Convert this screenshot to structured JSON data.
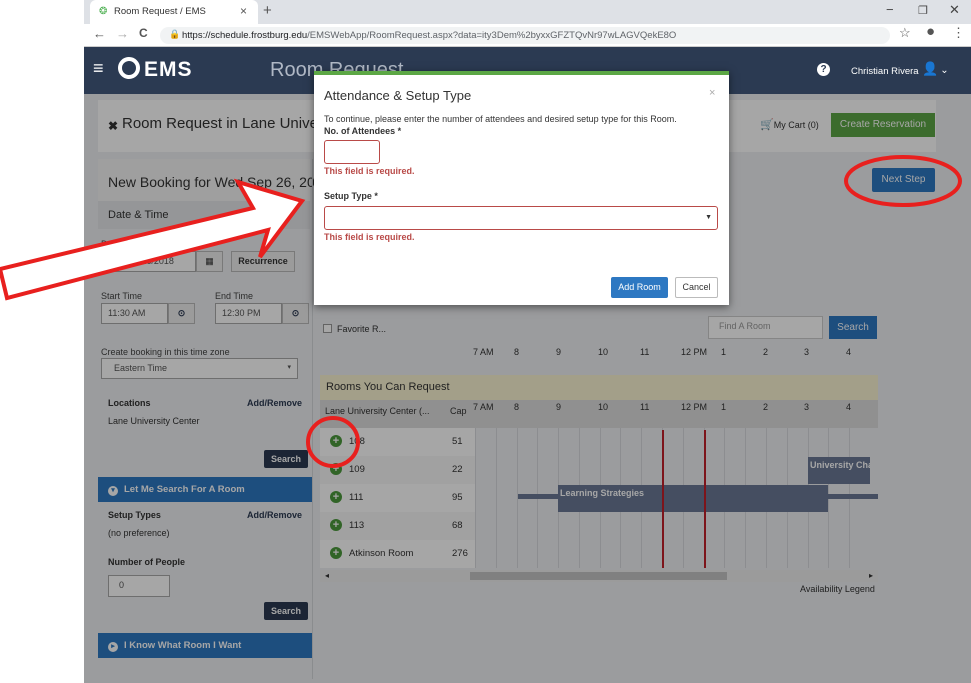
{
  "browser": {
    "tab_title": "Room Request / EMS",
    "tab_close": "×",
    "new_tab": "+",
    "url_host": "https://schedule.frostburg.edu",
    "url_path": "/EMSWebApp/RoomRequest.aspx?data=ity3Dem%2byxxGFZTQvNr97wLAGVQekE8O",
    "minimize": "−",
    "maximize": "❐",
    "close": "✕",
    "back": "←",
    "forward": "→",
    "reload": "C",
    "star": "☆",
    "menu": "⋮",
    "profile": "●"
  },
  "header": {
    "brand": "EMS",
    "page_title": "Room Request",
    "help": "?",
    "user_name": "Christian Rivera",
    "caret": "⌄"
  },
  "request": {
    "title": "Room Request in Lane University Center",
    "cart": "My Cart (0)",
    "create_reservation": "Create Reservation",
    "booking_title": "New Booking for Wed Sep 26, 2018",
    "next_step": "Next Step"
  },
  "sidebar": {
    "date_time_header": "Date & Time",
    "date_label": "Date",
    "date_value": "Wed 09/26/2018",
    "recurrence": "Recurrence",
    "start_time_label": "Start Time",
    "start_time": "11:30 AM",
    "end_time_label": "End Time",
    "end_time": "12:30 PM",
    "timezone_label": "Create booking in this time zone",
    "timezone_value": "Eastern Time",
    "locations_label": "Locations",
    "add_remove": "Add/Remove",
    "location_value": "Lane University Center",
    "search": "Search",
    "let_me_search": "Let Me Search For A Room",
    "setup_types_label": "Setup Types",
    "setup_value": "(no preference)",
    "people_label": "Number of People",
    "people_value": "0",
    "i_know": "I Know What Room I Want"
  },
  "grid": {
    "favorite": "Favorite R...",
    "find_room_placeholder": "Find A Room",
    "search": "Search",
    "hours": [
      "7 AM",
      "8",
      "9",
      "10",
      "11",
      "12 PM",
      "1",
      "2",
      "3",
      "4"
    ],
    "rooms_header": "Rooms You Can Request",
    "building_col": "Lane University Center (...",
    "cap_col": "Cap",
    "rooms": [
      {
        "name": "108",
        "cap": "51"
      },
      {
        "name": "109",
        "cap": "22"
      },
      {
        "name": "111",
        "cap": "95"
      },
      {
        "name": "113",
        "cap": "68"
      },
      {
        "name": "Atkinson Room",
        "cap": "276"
      }
    ],
    "booking_learning": "Learning Strategies",
    "booking_university": "University Cha",
    "legend": "Availability Legend",
    "scroll_left": "◂",
    "scroll_right": "▸"
  },
  "modal": {
    "title": "Attendance & Setup Type",
    "close": "×",
    "instructions": "To continue, please enter the number of attendees and desired setup type for this Room.",
    "attendees_label": "No. of Attendees *",
    "attendees_error": "This field is required.",
    "setup_label": "Setup Type *",
    "setup_error": "This field is required.",
    "add_room": "Add Room",
    "cancel": "Cancel"
  },
  "colors": {
    "header": "#2b3a52",
    "accent_green": "#5ca745",
    "button_blue": "#2d78c2",
    "error": "#b94a48",
    "annotation_red": "#e8201e"
  }
}
